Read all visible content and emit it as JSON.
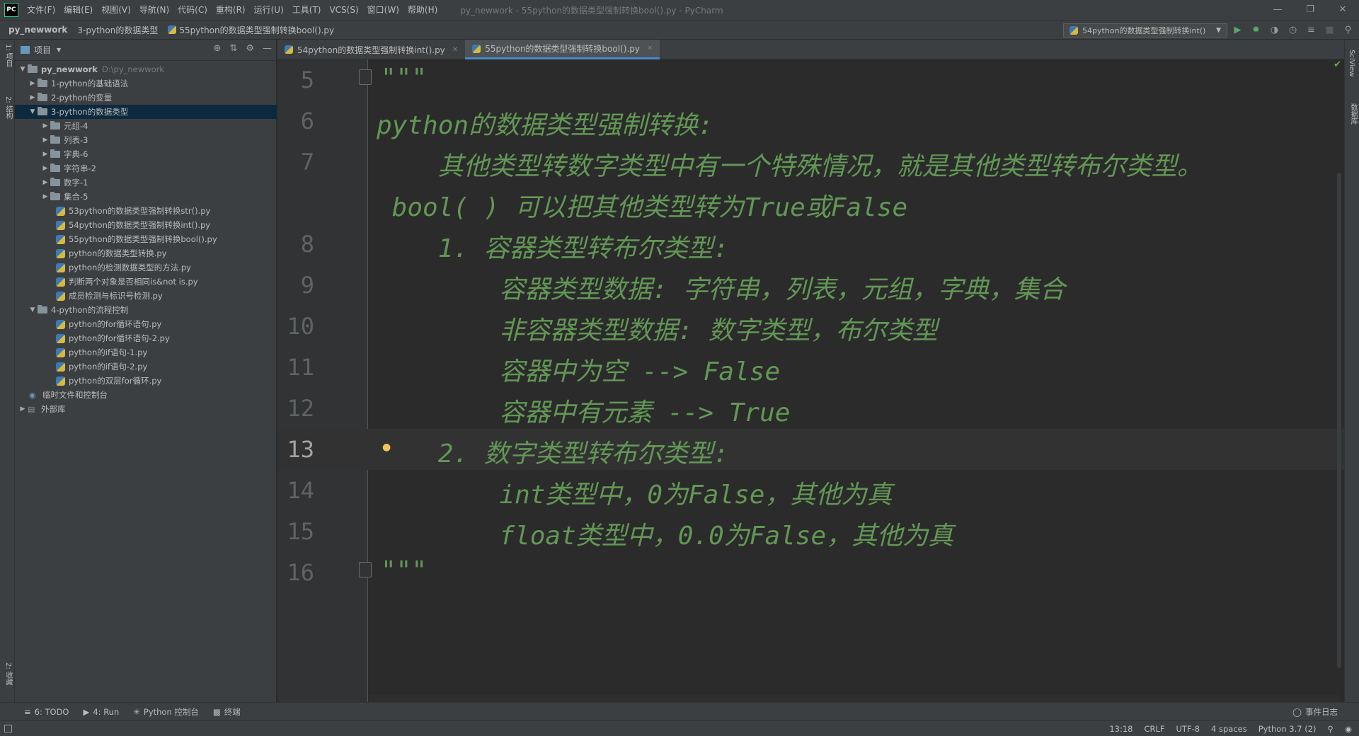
{
  "window": {
    "logo": "PC",
    "title": "py_newwork - 55python的数据类型强制转换bool().py - PyCharm",
    "menu": [
      "文件(F)",
      "编辑(E)",
      "视图(V)",
      "导航(N)",
      "代码(C)",
      "重构(R)",
      "运行(U)",
      "工具(T)",
      "VCS(S)",
      "窗口(W)",
      "帮助(H)"
    ]
  },
  "breadcrumb": {
    "project": "py_newwork",
    "folder": "3-python的数据类型",
    "file": "55python的数据类型强制转换bool().py"
  },
  "run_config": {
    "label": "54python的数据类型强制转换int()"
  },
  "left_stripe": {
    "project_label": "1: 项目",
    "structure_label": "2: 结构",
    "favorites_label": "2: 收藏"
  },
  "right_stripe": {
    "sciview_label": "SciView",
    "database_label": "数据库"
  },
  "project_panel": {
    "header": "项目",
    "tree": [
      {
        "label": "py_newwork",
        "path": "D:\\py_newwork",
        "type": "root"
      },
      {
        "label": "1-python的基础语法",
        "type": "folder"
      },
      {
        "label": "2-python的变量",
        "type": "folder"
      },
      {
        "label": "3-python的数据类型",
        "type": "folder",
        "selected": true
      },
      {
        "label": "元组-4",
        "type": "folder"
      },
      {
        "label": "列表-3",
        "type": "folder"
      },
      {
        "label": "字典-6",
        "type": "folder"
      },
      {
        "label": "字符串-2",
        "type": "folder"
      },
      {
        "label": "数字-1",
        "type": "folder"
      },
      {
        "label": "集合-5",
        "type": "folder"
      },
      {
        "label": "53python的数据类型强制转换str().py",
        "type": "file"
      },
      {
        "label": "54python的数据类型强制转换int().py",
        "type": "file"
      },
      {
        "label": "55python的数据类型强制转换bool().py",
        "type": "file"
      },
      {
        "label": "python的数据类型转换.py",
        "type": "file"
      },
      {
        "label": "python的检测数据类型的方法.py",
        "type": "file"
      },
      {
        "label": "判断两个对象是否相同is&not is.py",
        "type": "file"
      },
      {
        "label": "成员检测与标识号检测.py",
        "type": "file"
      },
      {
        "label": "4-python的流程控制",
        "type": "folder"
      },
      {
        "label": "python的for循环语句.py",
        "type": "file"
      },
      {
        "label": "python的for循环语句-2.py",
        "type": "file"
      },
      {
        "label": "python的if语句-1.py",
        "type": "file"
      },
      {
        "label": "python的if语句-2.py",
        "type": "file"
      },
      {
        "label": "python的双层for循环.py",
        "type": "file"
      },
      {
        "label": "临时文件和控制台",
        "type": "scratch"
      },
      {
        "label": "外部库",
        "type": "library"
      }
    ]
  },
  "editor_tabs": [
    {
      "label": "54python的数据类型强制转换int().py",
      "active": false
    },
    {
      "label": "55python的数据类型强制转换bool().py",
      "active": true
    }
  ],
  "code_lines": [
    {
      "num": "5",
      "text": "\"\"\""
    },
    {
      "num": "6",
      "text": "python的数据类型强制转换:"
    },
    {
      "num": "7",
      "text": "    其他类型转数字类型中有一个特殊情况，就是其他类型转布尔类型。"
    },
    {
      "num": "",
      "text": " bool( ) 可以把其他类型转为True或False"
    },
    {
      "num": "8",
      "text": "    1. 容器类型转布尔类型:"
    },
    {
      "num": "9",
      "text": "        容器类型数据: 字符串，列表，元组，字典，集合"
    },
    {
      "num": "10",
      "text": "        非容器类型数据: 数字类型，布尔类型"
    },
    {
      "num": "11",
      "text": "        容器中为空 --> False"
    },
    {
      "num": "12",
      "text": "        容器中有元素 --> True"
    },
    {
      "num": "13",
      "text": "    2. 数字类型转布尔类型:"
    },
    {
      "num": "14",
      "text": "        int类型中，0为False，其他为真"
    },
    {
      "num": "15",
      "text": "        float类型中，0.0为False，其他为真"
    },
    {
      "num": "16",
      "text": "\"\"\""
    }
  ],
  "current_line": "13",
  "tool_tabs": [
    {
      "label": "6: TODO",
      "icon": "list-icon"
    },
    {
      "label": "4: Run",
      "icon": "play-icon"
    },
    {
      "label": "Python 控制台",
      "icon": "python-icon"
    },
    {
      "label": "终端",
      "icon": "terminal-icon"
    }
  ],
  "event_log": "事件日志",
  "status": {
    "position": "13:18",
    "line_sep": "CRLF",
    "encoding": "UTF-8",
    "indent": "4 spaces",
    "interpreter": "Python 3.7 (2)"
  },
  "colors": {
    "docstring": "#629755",
    "line_number": "#606366",
    "selection": "#0d293e",
    "tab_accent": "#4a88c7"
  }
}
